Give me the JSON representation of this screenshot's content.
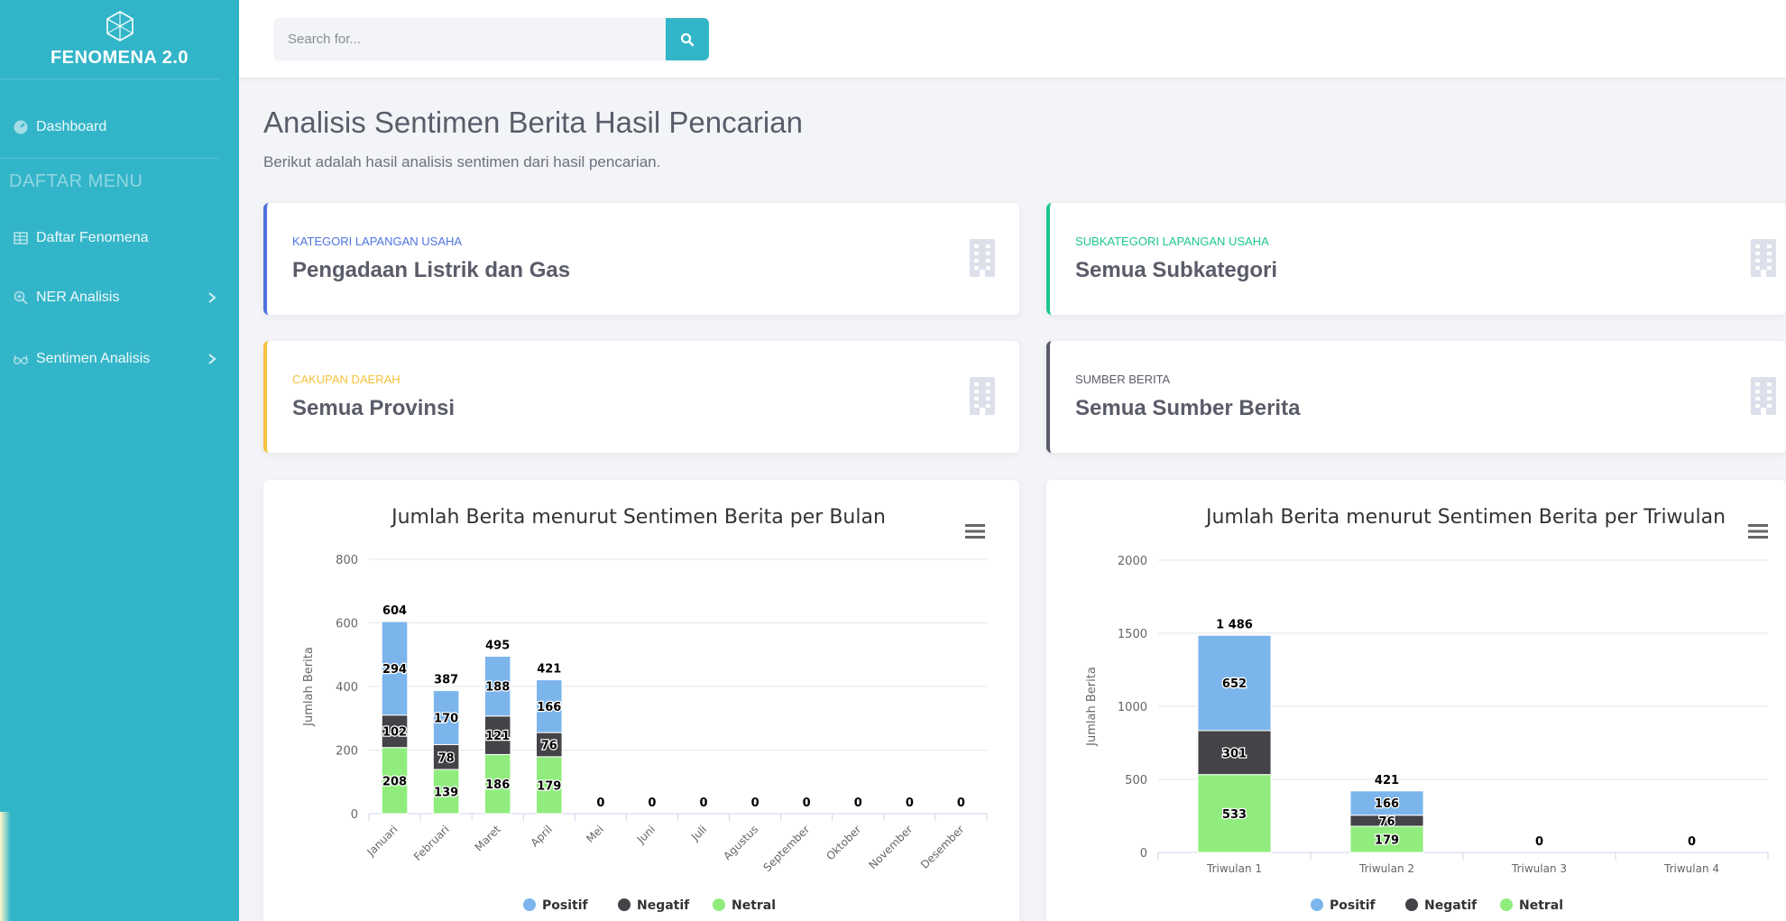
{
  "sidebar": {
    "brand": "FENOMENA 2.0",
    "dashboard": "Dashboard",
    "heading": "DAFTAR MENU",
    "items": [
      {
        "label": "Daftar Fenomena"
      },
      {
        "label": "NER Analisis"
      },
      {
        "label": "Sentimen Analisis"
      }
    ]
  },
  "search": {
    "placeholder": "Search for..."
  },
  "page": {
    "title": "Analisis Sentimen Berita Hasil Pencarian",
    "subtitle": "Berikut adalah hasil analisis sentimen dari hasil pencarian."
  },
  "cards": [
    {
      "label": "KATEGORI LAPANGAN USAHA",
      "value": "Pengadaan Listrik dan Gas",
      "color": "#4e73df"
    },
    {
      "label": "SUBKATEGORI LAPANGAN USAHA",
      "value": "Semua Subkategori",
      "color": "#1cc88a"
    },
    {
      "label": "CAKUPAN DAERAH",
      "value": "Semua Provinsi",
      "color": "#f6c23e"
    },
    {
      "label": "SUMBER BERITA",
      "value": "Semua Sumber Berita",
      "color": "#5a5c69"
    }
  ],
  "colors": {
    "accent": "#33b5c9",
    "positif": "#7cb5ec",
    "negatif": "#434348",
    "netral": "#90ed7d"
  },
  "chart_data": [
    {
      "type": "bar",
      "stacked": true,
      "title": "Jumlah Berita menurut Sentimen Berita per Bulan",
      "ylabel": "Jumlah Berita",
      "xlabel": "",
      "ylim": [
        0,
        800
      ],
      "yticks": [
        0,
        200,
        400,
        600,
        800
      ],
      "categories": [
        "Januari",
        "Februari",
        "Maret",
        "April",
        "Mei",
        "Juni",
        "Juli",
        "Agustus",
        "September",
        "Oktober",
        "November",
        "Desember"
      ],
      "series": [
        {
          "name": "Positif",
          "values": [
            294,
            170,
            188,
            166,
            0,
            0,
            0,
            0,
            0,
            0,
            0,
            0
          ]
        },
        {
          "name": "Negatif",
          "values": [
            102,
            78,
            121,
            76,
            0,
            0,
            0,
            0,
            0,
            0,
            0,
            0
          ]
        },
        {
          "name": "Netral",
          "values": [
            208,
            139,
            186,
            179,
            0,
            0,
            0,
            0,
            0,
            0,
            0,
            0
          ]
        }
      ],
      "totals": [
        "604",
        "387",
        "495",
        "421",
        "0",
        "0",
        "0",
        "0",
        "0",
        "0",
        "0",
        "0"
      ],
      "legend": "bottom"
    },
    {
      "type": "bar",
      "stacked": true,
      "title": "Jumlah Berita menurut Sentimen Berita per Triwulan",
      "ylabel": "Jumlah Berita",
      "xlabel": "",
      "ylim": [
        0,
        2000
      ],
      "yticks": [
        0,
        500,
        1000,
        1500,
        2000
      ],
      "categories": [
        "Triwulan 1",
        "Triwulan 2",
        "Triwulan 3",
        "Triwulan 4"
      ],
      "series": [
        {
          "name": "Positif",
          "values": [
            652,
            166,
            0,
            0
          ]
        },
        {
          "name": "Negatif",
          "values": [
            301,
            76,
            0,
            0
          ]
        },
        {
          "name": "Netral",
          "values": [
            533,
            179,
            0,
            0
          ]
        }
      ],
      "totals": [
        "1 486",
        "421",
        "0",
        "0"
      ],
      "legend": "bottom"
    }
  ]
}
